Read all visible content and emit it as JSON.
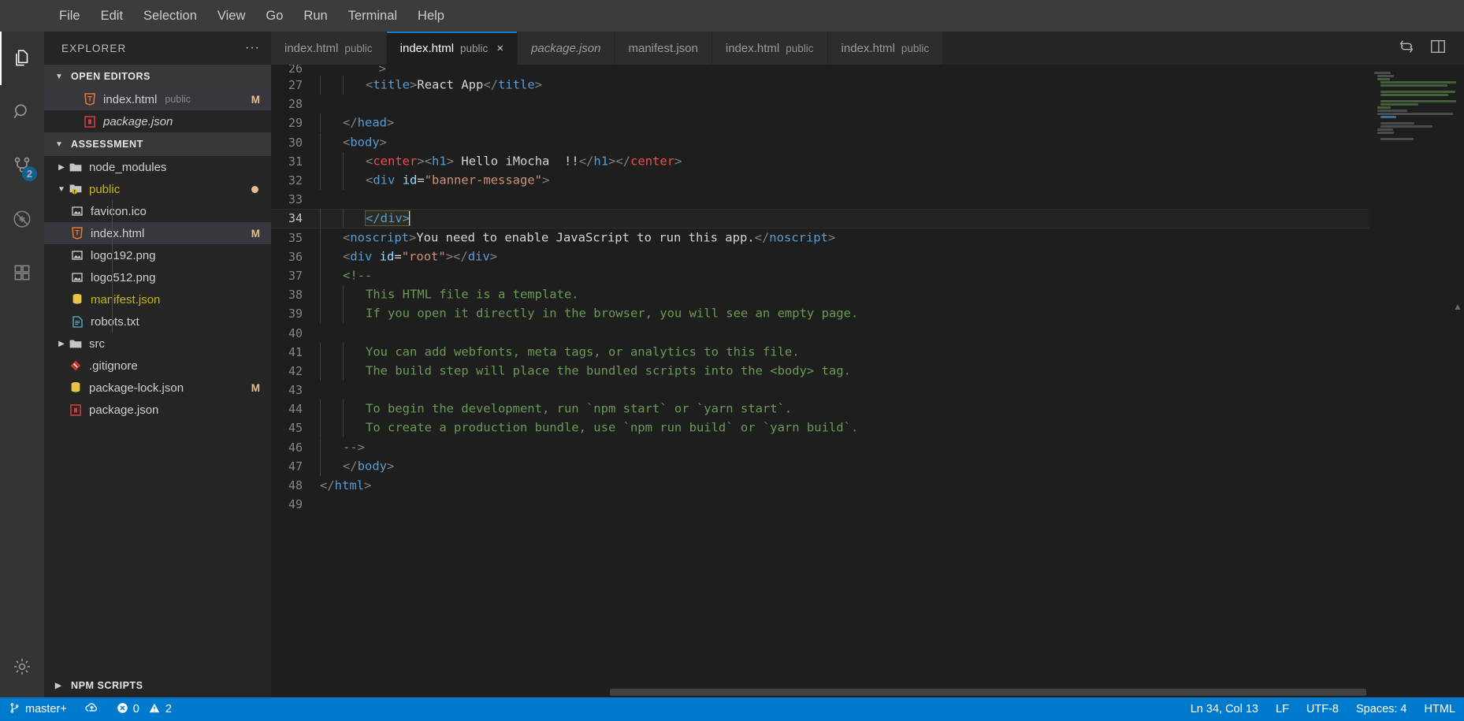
{
  "menu": {
    "items": [
      "File",
      "Edit",
      "Selection",
      "View",
      "Go",
      "Run",
      "Terminal",
      "Help"
    ]
  },
  "activity_bar": {
    "items": [
      {
        "name": "explorer-icon",
        "label": "Explorer",
        "badge": ""
      },
      {
        "name": "search-icon",
        "label": "Search",
        "badge": ""
      },
      {
        "name": "source-control-icon",
        "label": "Source Control",
        "badge": "2"
      },
      {
        "name": "run-debug-icon",
        "label": "Run and Debug",
        "badge": ""
      },
      {
        "name": "extensions-icon",
        "label": "Extensions",
        "badge": ""
      },
      {
        "name": "settings-gear-icon",
        "label": "Manage",
        "badge": ""
      }
    ]
  },
  "sidebar": {
    "title": "EXPLORER",
    "more_actions": "···",
    "open_editors": {
      "label": "OPEN EDITORS",
      "items": [
        {
          "name": "index.html",
          "sub": "public",
          "status": "M",
          "icon": "html-file-icon",
          "selected": true,
          "italic": false
        },
        {
          "name": "package.json",
          "sub": "",
          "status": "",
          "icon": "json-file-icon",
          "selected": false,
          "italic": true
        }
      ]
    },
    "workspace": {
      "label": "ASSESSMENT",
      "items": [
        {
          "name": "node_modules",
          "type": "folder",
          "expanded": false,
          "depth": 0,
          "icon": "folder-icon",
          "status": "",
          "warn": false
        },
        {
          "name": "public",
          "type": "folder",
          "expanded": true,
          "depth": 0,
          "icon": "folder-warning-icon",
          "status": "dot",
          "warn": true
        },
        {
          "name": "favicon.ico",
          "type": "file",
          "depth": 1,
          "icon": "image-file-icon",
          "status": "",
          "warn": false,
          "selected": false
        },
        {
          "name": "index.html",
          "type": "file",
          "depth": 1,
          "icon": "html-file-icon",
          "status": "M",
          "warn": false,
          "selected": true
        },
        {
          "name": "logo192.png",
          "type": "file",
          "depth": 1,
          "icon": "image-file-icon",
          "status": "",
          "warn": false,
          "selected": false
        },
        {
          "name": "logo512.png",
          "type": "file",
          "depth": 1,
          "icon": "image-file-icon",
          "status": "",
          "warn": false,
          "selected": false
        },
        {
          "name": "manifest.json",
          "type": "file",
          "depth": 1,
          "icon": "json-warning-icon",
          "status": "",
          "warn": true,
          "selected": false
        },
        {
          "name": "robots.txt",
          "type": "file",
          "depth": 1,
          "icon": "text-file-icon",
          "status": "",
          "warn": false,
          "selected": false
        },
        {
          "name": "src",
          "type": "folder",
          "expanded": false,
          "depth": 0,
          "icon": "folder-icon",
          "status": "",
          "warn": false
        },
        {
          "name": ".gitignore",
          "type": "file",
          "depth": 0,
          "icon": "git-file-icon",
          "status": "",
          "warn": false,
          "selected": false
        },
        {
          "name": "package-lock.json",
          "type": "file",
          "depth": 0,
          "icon": "lock-json-file-icon",
          "status": "M",
          "warn": false,
          "selected": false
        },
        {
          "name": "package.json",
          "type": "file",
          "depth": 0,
          "icon": "json-file-icon",
          "status": "",
          "warn": false,
          "selected": false
        }
      ]
    },
    "npm_scripts": {
      "label": "NPM SCRIPTS"
    }
  },
  "tabs": [
    {
      "name": "index.html",
      "sub": "public",
      "active": false,
      "italic": false,
      "closable": false
    },
    {
      "name": "index.html",
      "sub": "public",
      "active": true,
      "italic": false,
      "closable": true,
      "close": "×"
    },
    {
      "name": "package.json",
      "sub": "",
      "active": false,
      "italic": true,
      "closable": false
    },
    {
      "name": "manifest.json",
      "sub": "",
      "active": false,
      "italic": false,
      "closable": false
    },
    {
      "name": "index.html",
      "sub": "public",
      "active": false,
      "italic": false,
      "closable": false
    },
    {
      "name": "index.html",
      "sub": "public",
      "active": false,
      "italic": false,
      "closable": false
    }
  ],
  "editor_actions": [
    {
      "name": "split-editor-icon"
    },
    {
      "name": "open-changes-icon"
    }
  ],
  "code": {
    "first_visible_line": 26,
    "current_line": 34,
    "lines": [
      {
        "n": 27,
        "indent": 2,
        "tokens": [
          {
            "t": "<",
            "c": "punc"
          },
          {
            "t": "title",
            "c": "tag"
          },
          {
            "t": ">",
            "c": "punc"
          },
          {
            "t": "React App",
            "c": "plain"
          },
          {
            "t": "</",
            "c": "punc"
          },
          {
            "t": "title",
            "c": "tag"
          },
          {
            "t": ">",
            "c": "punc"
          }
        ]
      },
      {
        "n": 28,
        "indent": 0,
        "tokens": []
      },
      {
        "n": 29,
        "indent": 1,
        "tokens": [
          {
            "t": "</",
            "c": "punc"
          },
          {
            "t": "head",
            "c": "tag"
          },
          {
            "t": ">",
            "c": "punc"
          }
        ]
      },
      {
        "n": 30,
        "indent": 1,
        "tokens": [
          {
            "t": "<",
            "c": "punc"
          },
          {
            "t": "body",
            "c": "tag"
          },
          {
            "t": ">",
            "c": "punc"
          }
        ]
      },
      {
        "n": 31,
        "indent": 2,
        "tokens": [
          {
            "t": "<",
            "c": "punc"
          },
          {
            "t": "center",
            "c": "red"
          },
          {
            "t": ">",
            "c": "punc"
          },
          {
            "t": "<",
            "c": "punc"
          },
          {
            "t": "h1",
            "c": "tag"
          },
          {
            "t": ">",
            "c": "punc"
          },
          {
            "t": " Hello iMocha  !!",
            "c": "plain"
          },
          {
            "t": "</",
            "c": "punc"
          },
          {
            "t": "h1",
            "c": "tag"
          },
          {
            "t": ">",
            "c": "punc"
          },
          {
            "t": "</",
            "c": "punc"
          },
          {
            "t": "center",
            "c": "red"
          },
          {
            "t": ">",
            "c": "punc"
          }
        ]
      },
      {
        "n": 32,
        "indent": 2,
        "tokens": [
          {
            "t": "<",
            "c": "punc"
          },
          {
            "t": "div",
            "c": "tag"
          },
          {
            "t": " ",
            "c": "plain"
          },
          {
            "t": "id",
            "c": "attr"
          },
          {
            "t": "=",
            "c": "plain"
          },
          {
            "t": "\"banner-message\"",
            "c": "str"
          },
          {
            "t": ">",
            "c": "punc"
          }
        ]
      },
      {
        "n": 33,
        "indent": 0,
        "tokens": []
      },
      {
        "n": 34,
        "indent": 2,
        "tokens": [
          {
            "t": "</div>",
            "c": "tag",
            "bracket": true
          },
          {
            "t": "",
            "c": "cursor"
          }
        ]
      },
      {
        "n": 35,
        "indent": 1,
        "tokens": [
          {
            "t": "<",
            "c": "punc"
          },
          {
            "t": "noscript",
            "c": "tag"
          },
          {
            "t": ">",
            "c": "punc"
          },
          {
            "t": "You need to enable JavaScript to run this app.",
            "c": "plain"
          },
          {
            "t": "</",
            "c": "punc"
          },
          {
            "t": "noscript",
            "c": "tag"
          },
          {
            "t": ">",
            "c": "punc"
          }
        ]
      },
      {
        "n": 36,
        "indent": 1,
        "tokens": [
          {
            "t": "<",
            "c": "punc"
          },
          {
            "t": "div",
            "c": "tag"
          },
          {
            "t": " ",
            "c": "plain"
          },
          {
            "t": "id",
            "c": "attr"
          },
          {
            "t": "=",
            "c": "plain"
          },
          {
            "t": "\"root\"",
            "c": "str"
          },
          {
            "t": ">",
            "c": "punc"
          },
          {
            "t": "</",
            "c": "punc"
          },
          {
            "t": "div",
            "c": "tag"
          },
          {
            "t": ">",
            "c": "punc"
          }
        ]
      },
      {
        "n": 37,
        "indent": 1,
        "tokens": [
          {
            "t": "<!--",
            "c": "com"
          }
        ]
      },
      {
        "n": 38,
        "indent": 2,
        "tokens": [
          {
            "t": "This HTML file is a template.",
            "c": "com"
          }
        ]
      },
      {
        "n": 39,
        "indent": 2,
        "tokens": [
          {
            "t": "If you open it directly in the browser, you will see an empty page.",
            "c": "com"
          }
        ]
      },
      {
        "n": 40,
        "indent": 0,
        "tokens": []
      },
      {
        "n": 41,
        "indent": 2,
        "tokens": [
          {
            "t": "You can add webfonts, meta tags, or analytics to this file.",
            "c": "com"
          }
        ]
      },
      {
        "n": 42,
        "indent": 2,
        "tokens": [
          {
            "t": "The build step will place the bundled scripts into the <body> tag.",
            "c": "com"
          }
        ]
      },
      {
        "n": 43,
        "indent": 0,
        "tokens": []
      },
      {
        "n": 44,
        "indent": 2,
        "tokens": [
          {
            "t": "To begin the development, run `npm start` or `yarn start`.",
            "c": "com"
          }
        ]
      },
      {
        "n": 45,
        "indent": 2,
        "tokens": [
          {
            "t": "To create a production bundle, use `npm run build` or `yarn build`.",
            "c": "com"
          }
        ]
      },
      {
        "n": 46,
        "indent": 1,
        "tokens": [
          {
            "t": "--",
            "c": "com"
          },
          {
            "t": ">",
            "c": "punc"
          }
        ]
      },
      {
        "n": 47,
        "indent": 1,
        "tokens": [
          {
            "t": "</",
            "c": "punc"
          },
          {
            "t": "body",
            "c": "tag"
          },
          {
            "t": ">",
            "c": "punc"
          }
        ]
      },
      {
        "n": 48,
        "indent": 0,
        "tokens": [
          {
            "t": "</",
            "c": "punc"
          },
          {
            "t": "html",
            "c": "tag"
          },
          {
            "t": ">",
            "c": "punc"
          }
        ]
      },
      {
        "n": 49,
        "indent": 0,
        "tokens": []
      }
    ]
  },
  "status_bar": {
    "branch": "master+",
    "branch_icon": "source-control-branch-icon",
    "sync_icon": "cloud-upload-icon",
    "errors": "0",
    "warnings": "2",
    "position": "Ln 34, Col 13",
    "eol": "LF",
    "encoding": "UTF-8",
    "indentation": "Spaces: 4",
    "language": "HTML"
  },
  "colors": {
    "accent": "#007acc",
    "tab_active_border": "#0d7ec4",
    "modified": "#e2c08d",
    "warning": "#cdb600",
    "comment": "#6a9955",
    "tag": "#569cd6",
    "string": "#ce9178",
    "attribute": "#9cdcfe"
  }
}
